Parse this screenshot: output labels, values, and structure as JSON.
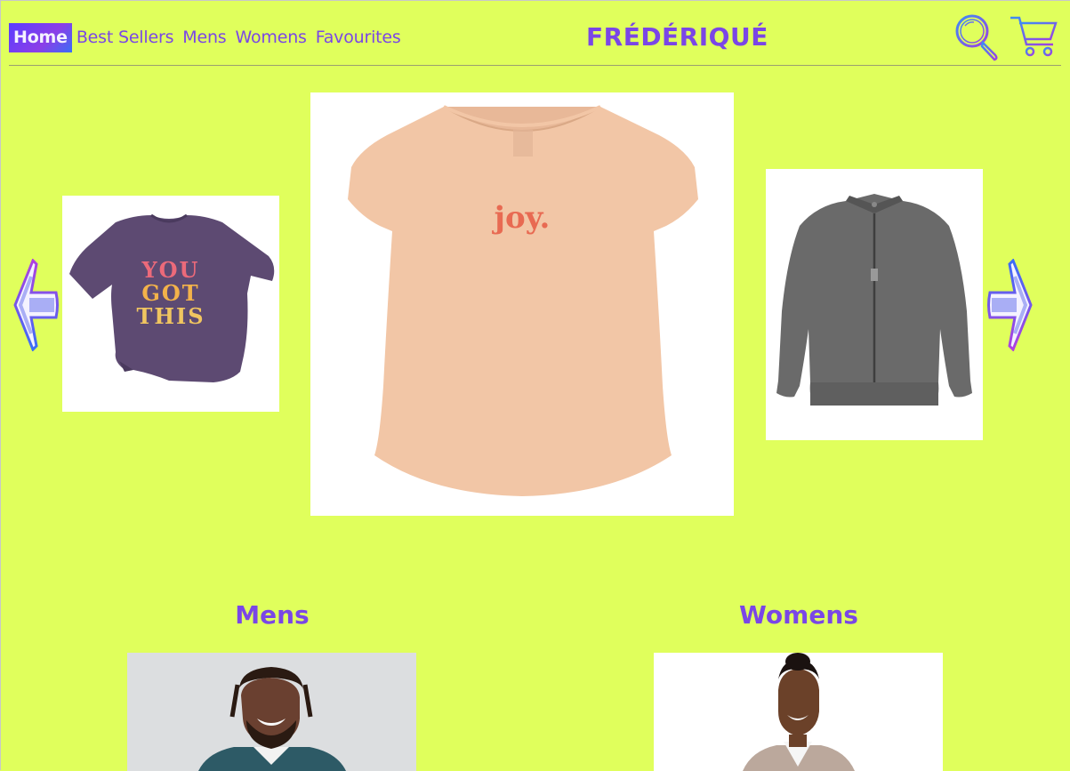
{
  "nav": {
    "items": [
      {
        "label": "Home",
        "active": true
      },
      {
        "label": "Best Sellers",
        "active": false
      },
      {
        "label": "Mens",
        "active": false
      },
      {
        "label": "Womens",
        "active": false
      },
      {
        "label": "Favourites",
        "active": false
      }
    ]
  },
  "brand": {
    "name": "FRÉDÉRIQUÉ"
  },
  "header_icons": {
    "search": "search-icon",
    "cart": "cart-icon"
  },
  "carousel": {
    "left_item": {
      "description": "purple t-shirt",
      "print_lines": [
        "YOU",
        "GOT",
        "THIS"
      ]
    },
    "center_item": {
      "description": "peach t-shirt",
      "print": "joy."
    },
    "right_item": {
      "description": "grey jacket"
    },
    "prev_icon": "arrow-left-icon",
    "next_icon": "arrow-right-icon"
  },
  "categories": [
    {
      "title": "Mens"
    },
    {
      "title": "Womens"
    }
  ],
  "colors": {
    "background": "#e0ff5c",
    "accent": "#7a46e6",
    "active_nav_gradient_start": "#5a3dff",
    "active_nav_gradient_end": "#3b6ef5"
  }
}
